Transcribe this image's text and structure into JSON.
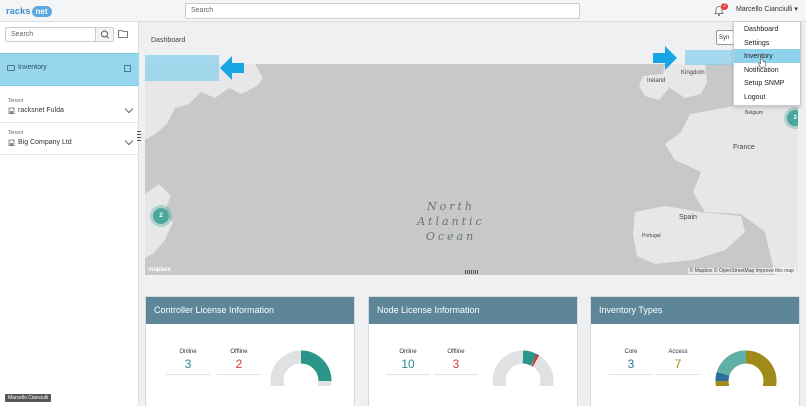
{
  "app": {
    "logo_text": "racks",
    "logo_cloud": "net"
  },
  "topbar": {
    "search_placeholder": "Search",
    "notification_count": "2",
    "user_name": "Marcello Cianciulli"
  },
  "sidebar": {
    "search_placeholder": "Search",
    "selected_item": "Inventory",
    "tenants": [
      {
        "label": "Tenant",
        "value": "racksnet Fulda"
      },
      {
        "label": "Tenant",
        "value": "Big Company Ltd"
      }
    ],
    "user_tag": "Marcello Cianciulli"
  },
  "main": {
    "page_label": "Dashboard",
    "sync_label": "Syn",
    "map": {
      "ocean_lines": [
        "North",
        "Atlantic",
        "Ocean"
      ],
      "places": [
        "Kingdom",
        "Ireland",
        "Belgium",
        "France",
        "Spain",
        "Portugal"
      ],
      "clusters": [
        "2",
        "3"
      ],
      "attribution": "© Mapbox © OpenStreetMap Improve this map",
      "logo": "mapbox"
    }
  },
  "cards": [
    {
      "title": "Controller License Information",
      "stats": [
        {
          "k": "Online",
          "v": "3",
          "color": "#2a8a8a"
        },
        {
          "k": "Offline",
          "v": "2",
          "color": "#d23a3a"
        }
      ]
    },
    {
      "title": "Node License Information",
      "stats": [
        {
          "k": "Online",
          "v": "10",
          "color": "#2a8a8a"
        },
        {
          "k": "Offline",
          "v": "3",
          "color": "#d23a3a"
        }
      ]
    },
    {
      "title": "Inventory Types",
      "stats": [
        {
          "k": "Core",
          "v": "3",
          "color": "#2a6f9e"
        },
        {
          "k": "Access",
          "v": "7",
          "color": "#a08a18"
        }
      ]
    }
  ],
  "user_menu": {
    "items": [
      "Dashboard",
      "Settings",
      "Inventory",
      "Notification",
      "Setup SNMP",
      "Logout"
    ],
    "active": "Inventory"
  },
  "colors": {
    "highlight": "#8fd2ee",
    "arrow": "#16a6e6",
    "card_header": "#5d8699",
    "teal": "#2a9688"
  }
}
